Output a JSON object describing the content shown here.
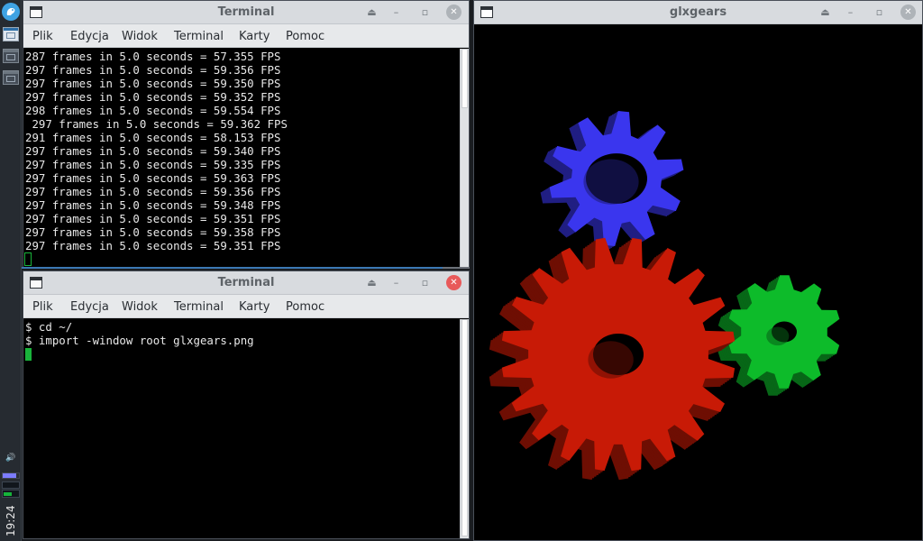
{
  "panel": {
    "logo_icon": "app-menu-icon",
    "clock": "19:24",
    "volume_icon": "volume-icon",
    "cpu_fraction": 0.85,
    "net_fraction": 0.45
  },
  "terminal_top": {
    "title": "Terminal",
    "menu": [
      "Plik",
      "Edycja",
      "Widok",
      "Terminal",
      "Karty",
      "Pomoc"
    ],
    "lines": [
      "287 frames in 5.0 seconds = 57.355 FPS",
      "297 frames in 5.0 seconds = 59.356 FPS",
      "297 frames in 5.0 seconds = 59.350 FPS",
      "297 frames in 5.0 seconds = 59.352 FPS",
      "298 frames in 5.0 seconds = 59.554 FPS",
      " 297 frames in 5.0 seconds = 59.362 FPS",
      "291 frames in 5.0 seconds = 58.153 FPS",
      "297 frames in 5.0 seconds = 59.340 FPS",
      "297 frames in 5.0 seconds = 59.335 FPS",
      "297 frames in 5.0 seconds = 59.363 FPS",
      "297 frames in 5.0 seconds = 59.356 FPS",
      "297 frames in 5.0 seconds = 59.348 FPS",
      "297 frames in 5.0 seconds = 59.351 FPS",
      "297 frames in 5.0 seconds = 59.358 FPS",
      "297 frames in 5.0 seconds = 59.351 FPS"
    ]
  },
  "terminal_bottom": {
    "title": "Terminal",
    "menu": [
      "Plik",
      "Edycja",
      "Widok",
      "Terminal",
      "Karty",
      "Pomoc"
    ],
    "lines": [
      "$ cd ~/",
      "$ import -window root glxgears.png"
    ]
  },
  "glxgears": {
    "title": "glxgears",
    "gear_colors": {
      "red": "#c81a06",
      "green": "#0dbb2a",
      "blue": "#3a36ee"
    }
  },
  "colors": {
    "accent": "#3b78b3",
    "cursor": "#19b43b",
    "close_active": "#e8595a"
  }
}
